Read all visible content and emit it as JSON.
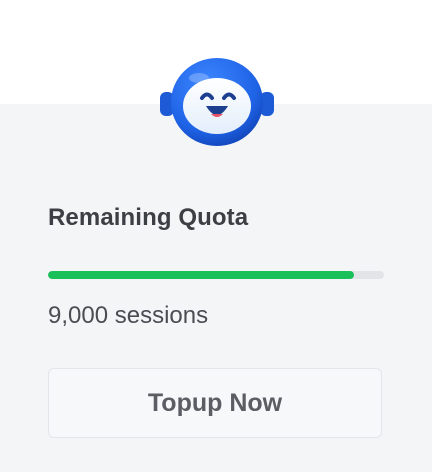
{
  "quota": {
    "title": "Remaining Quota",
    "value_text": "9,000 sessions",
    "progress_fraction": 0.91,
    "progress_color": "#19c05a"
  },
  "actions": {
    "topup_label": "Topup Now"
  },
  "mascot": {
    "icon": "robot-mascot-icon",
    "color": "#1f63e6"
  }
}
